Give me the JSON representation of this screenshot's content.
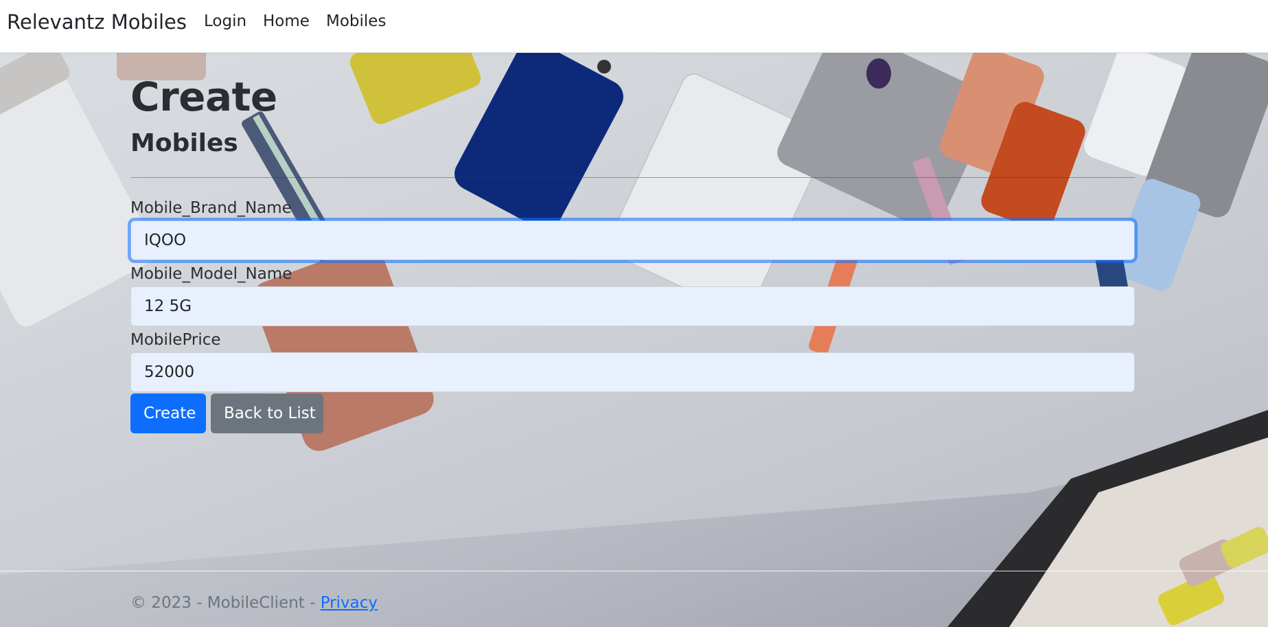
{
  "navbar": {
    "brand": "Relevantz Mobiles",
    "links": [
      {
        "label": "Login"
      },
      {
        "label": "Home"
      },
      {
        "label": "Mobiles"
      }
    ]
  },
  "page": {
    "title": "Create",
    "subtitle": "Mobiles"
  },
  "form": {
    "brand_name": {
      "label": "Mobile_Brand_Name",
      "value": "IQOO"
    },
    "model_name": {
      "label": "Mobile_Model_Name",
      "value": "12 5G"
    },
    "price": {
      "label": "MobilePrice",
      "value": "52000"
    },
    "create_button": "Create",
    "back_button": "Back to List"
  },
  "footer": {
    "text": "© 2023 - MobileClient - ",
    "privacy_link": "Privacy"
  },
  "colors": {
    "primary": "#0d6efd",
    "secondary": "#6c757d",
    "input_autofill_bg": "#e8f0fe"
  }
}
